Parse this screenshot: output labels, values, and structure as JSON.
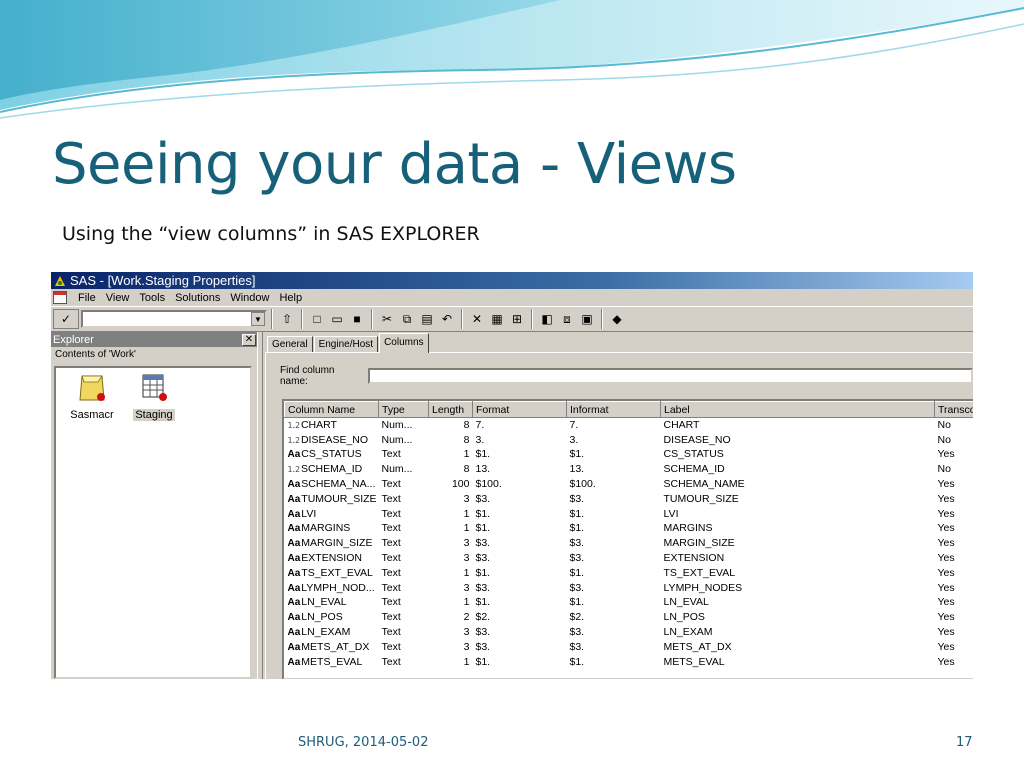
{
  "slide": {
    "title": "Seeing your data - Views",
    "subtitle": "Using the “view columns” in SAS EXPLORER",
    "footer": "SHRUG, 2014-05-02",
    "page_number": "17"
  },
  "window": {
    "title": "SAS - [Work.Staging Properties]",
    "menu": [
      "File",
      "View",
      "Tools",
      "Solutions",
      "Window",
      "Help"
    ]
  },
  "explorer": {
    "header": "Explorer",
    "contents_label": "Contents of 'Work'",
    "items": [
      {
        "label": "Sasmacr",
        "icon": "folder-icon"
      },
      {
        "label": "Staging",
        "icon": "table-icon",
        "selected": true
      }
    ]
  },
  "tabs": [
    "General",
    "Engine/Host",
    "Columns"
  ],
  "active_tab": "Columns",
  "find_label": "Find column name:",
  "columns_grid": {
    "headers": [
      "Column Name",
      "Type",
      "Length",
      "Format",
      "Informat",
      "Label",
      "Transco"
    ],
    "rows": [
      {
        "kind": "num",
        "name": "CHART",
        "type": "Num...",
        "length": "8",
        "format": "7.",
        "informat": "7.",
        "label": "CHART",
        "transcode": "No"
      },
      {
        "kind": "num",
        "name": "DISEASE_NO",
        "type": "Num...",
        "length": "8",
        "format": "3.",
        "informat": "3.",
        "label": "DISEASE_NO",
        "transcode": "No"
      },
      {
        "kind": "text",
        "name": "CS_STATUS",
        "type": "Text",
        "length": "1",
        "format": "$1.",
        "informat": "$1.",
        "label": "CS_STATUS",
        "transcode": "Yes"
      },
      {
        "kind": "num",
        "name": "SCHEMA_ID",
        "type": "Num...",
        "length": "8",
        "format": "13.",
        "informat": "13.",
        "label": "SCHEMA_ID",
        "transcode": "No"
      },
      {
        "kind": "text",
        "name": "SCHEMA_NA...",
        "type": "Text",
        "length": "100",
        "format": "$100.",
        "informat": "$100.",
        "label": "SCHEMA_NAME",
        "transcode": "Yes"
      },
      {
        "kind": "text",
        "name": "TUMOUR_SIZE",
        "type": "Text",
        "length": "3",
        "format": "$3.",
        "informat": "$3.",
        "label": "TUMOUR_SIZE",
        "transcode": "Yes"
      },
      {
        "kind": "text",
        "name": "LVI",
        "type": "Text",
        "length": "1",
        "format": "$1.",
        "informat": "$1.",
        "label": "LVI",
        "transcode": "Yes"
      },
      {
        "kind": "text",
        "name": "MARGINS",
        "type": "Text",
        "length": "1",
        "format": "$1.",
        "informat": "$1.",
        "label": "MARGINS",
        "transcode": "Yes"
      },
      {
        "kind": "text",
        "name": "MARGIN_SIZE",
        "type": "Text",
        "length": "3",
        "format": "$3.",
        "informat": "$3.",
        "label": "MARGIN_SIZE",
        "transcode": "Yes"
      },
      {
        "kind": "text",
        "name": "EXTENSION",
        "type": "Text",
        "length": "3",
        "format": "$3.",
        "informat": "$3.",
        "label": "EXTENSION",
        "transcode": "Yes"
      },
      {
        "kind": "text",
        "name": "TS_EXT_EVAL",
        "type": "Text",
        "length": "1",
        "format": "$1.",
        "informat": "$1.",
        "label": "TS_EXT_EVAL",
        "transcode": "Yes"
      },
      {
        "kind": "text",
        "name": "LYMPH_NOD...",
        "type": "Text",
        "length": "3",
        "format": "$3.",
        "informat": "$3.",
        "label": "LYMPH_NODES",
        "transcode": "Yes"
      },
      {
        "kind": "text",
        "name": "LN_EVAL",
        "type": "Text",
        "length": "1",
        "format": "$1.",
        "informat": "$1.",
        "label": "LN_EVAL",
        "transcode": "Yes"
      },
      {
        "kind": "text",
        "name": "LN_POS",
        "type": "Text",
        "length": "2",
        "format": "$2.",
        "informat": "$2.",
        "label": "LN_POS",
        "transcode": "Yes"
      },
      {
        "kind": "text",
        "name": "LN_EXAM",
        "type": "Text",
        "length": "3",
        "format": "$3.",
        "informat": "$3.",
        "label": "LN_EXAM",
        "transcode": "Yes"
      },
      {
        "kind": "text",
        "name": "METS_AT_DX",
        "type": "Text",
        "length": "3",
        "format": "$3.",
        "informat": "$3.",
        "label": "METS_AT_DX",
        "transcode": "Yes"
      },
      {
        "kind": "text",
        "name": "METS_EVAL",
        "type": "Text",
        "length": "1",
        "format": "$1.",
        "informat": "$1.",
        "label": "METS_EVAL",
        "transcode": "Yes"
      }
    ]
  },
  "colors": {
    "title": "#17607a",
    "titlebar": "#0a246a",
    "window_bg": "#d4d0c8",
    "wave": "#5bc0d8"
  }
}
